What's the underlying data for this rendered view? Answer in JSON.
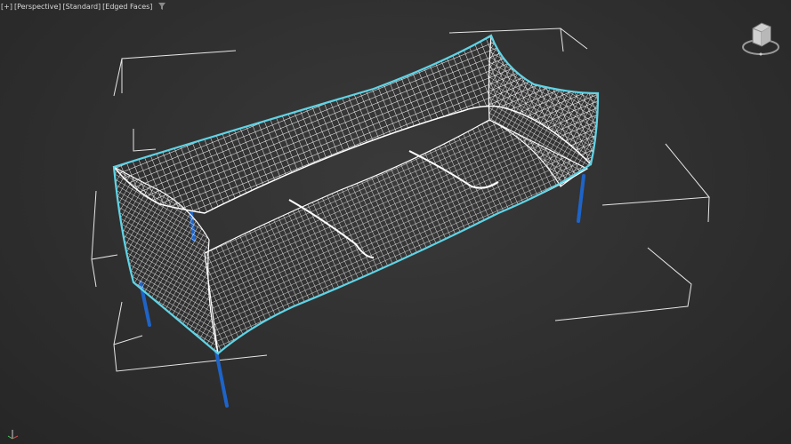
{
  "viewport": {
    "label_plus": "[+]",
    "label_view": "[Perspective]",
    "label_shading": "[Standard]",
    "label_display": "[Edged Faces]",
    "filter_icon": "funnel-icon",
    "viewcube_icon": "viewcube-icon",
    "axis_icon": "axis-tripod-icon"
  },
  "colors": {
    "background": "#2f2f2f",
    "wire": "#ffffff",
    "selection_outline": "#5fd4e6",
    "legs": "#1e64c8",
    "bbox_brackets": "#e6e6e6",
    "label_text": "#d8d8d8"
  }
}
